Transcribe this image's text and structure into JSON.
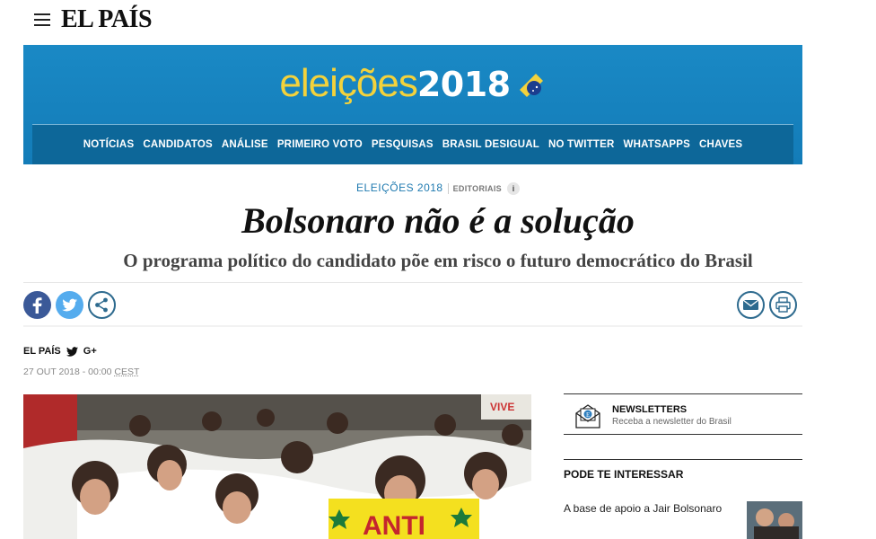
{
  "header": {
    "logo": "EL PAÍS"
  },
  "banner": {
    "title_light": "eleições",
    "title_bold": "2018",
    "nav": [
      "NOTÍCIAS",
      "CANDIDATOS",
      "ANÁLISE",
      "PRIMEIRO VOTO",
      "PESQUISAS",
      "BRASIL DESIGUAL",
      "NO TWITTER",
      "WHATSAPPS",
      "CHAVES"
    ]
  },
  "article": {
    "section": "ELEIÇÕES 2018",
    "tag": "EDITORIAIS",
    "info_glyph": "i",
    "headline": "Bolsonaro não é a solução",
    "subhead": "O programa político do candidato põe em risco o futuro democrático do Brasil",
    "author": "EL PAÍS",
    "author_gplus": "G+",
    "date": "27 OUT 2018 - 00:00 ",
    "timezone": "CEST",
    "photo_sign_text": "ANTI",
    "photo_banner_text": "VIVE"
  },
  "sidebar": {
    "newsletter_title": "NEWSLETTERS",
    "newsletter_desc": "Receba a newsletter do Brasil",
    "interest_heading": "PODE TE INTERESSAR",
    "interest_item": "A base de apoio a Jair Bolsonaro"
  },
  "colors": {
    "banner_blue": "#137cb8",
    "nav_blue": "#0d6799",
    "banner_yellow": "#f3d23c",
    "facebook": "#3b5998",
    "twitter": "#55acee"
  },
  "icons": [
    "menu-icon",
    "flag-icon",
    "info-icon",
    "facebook-icon",
    "twitter-icon",
    "share-icon",
    "email-icon",
    "print-icon",
    "twitter-small-icon",
    "newsletter-icon"
  ]
}
